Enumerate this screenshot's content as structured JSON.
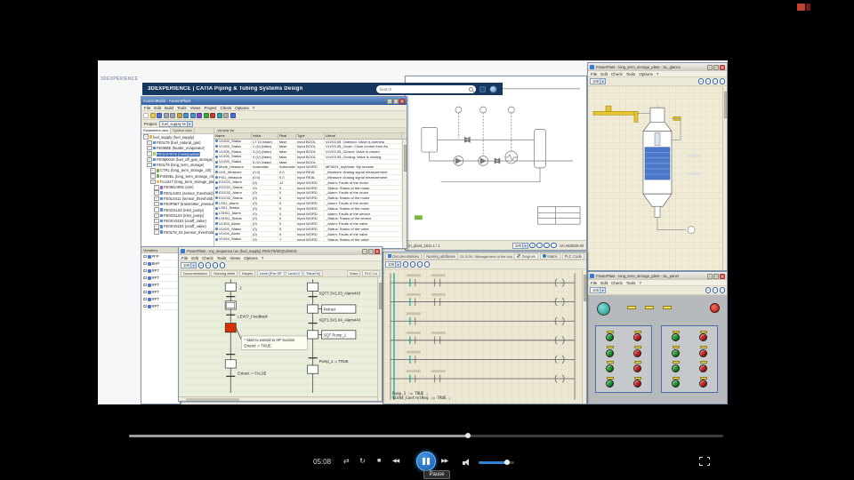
{
  "chrome": {
    "minimize": "–",
    "maximize": "□",
    "close": "×",
    "dropdown": "▾"
  },
  "player_icons": {
    "shuffle": "⇄",
    "repeat": "↻",
    "stop": "■",
    "rewind": "◀◀",
    "forward": "▶▶"
  },
  "desktop": {
    "logo": "3DEXPERIENCE",
    "top_bar": {
      "title": "3DEXPERIENCE | CATIA Piping & Tubing Systems Design",
      "search_placeholder": "Search"
    }
  },
  "controlbuild": {
    "title": "ControlBuild - AssemPlant",
    "menus": [
      "File",
      "Edit",
      "Build",
      "Tools",
      "Views",
      "Project",
      "Check",
      "Options",
      "?"
    ],
    "toolbar_icons": [
      {
        "name": "new-icon",
        "color": "#f8f8f8"
      },
      {
        "name": "open-icon",
        "color": "#e8c84a"
      },
      {
        "name": "save-icon",
        "color": "#4a6fd0"
      },
      {
        "name": "cut-icon",
        "color": "#9aa4b8"
      },
      {
        "name": "copy-icon",
        "color": "#9aa4b8"
      },
      {
        "name": "paste-icon",
        "color": "#c8a24a"
      },
      {
        "name": "undo-icon",
        "color": "#4a8fd0"
      },
      {
        "name": "redo-icon",
        "color": "#4a8fd0"
      },
      {
        "name": "compile-icon",
        "color": "#7a4ad0"
      },
      {
        "name": "run-icon",
        "color": "#3aa83a"
      },
      {
        "name": "stop-icon",
        "color": "#c83a3a"
      },
      {
        "name": "debug-icon",
        "color": "#3a9aa8"
      },
      {
        "name": "grid-icon",
        "color": "#b0b0b0"
      },
      {
        "name": "help-icon",
        "color": "#4a6fd0"
      }
    ],
    "project_label": "Project",
    "project_value": "fuel_supply M",
    "tree_tabs": [
      "Parameters view",
      "System view"
    ],
    "tree": [
      {
        "label": "fuel_supply (fuel_supply)",
        "depth": 0,
        "icon": "#e8b64c"
      },
      {
        "label": "FE0LT9 (fuel_natural_gas)",
        "depth": 1,
        "icon": "#5b8dd9"
      },
      {
        "label": "FE09ME (heater_evaporator)",
        "depth": 1,
        "icon": "#5b8dd9"
      },
      {
        "label": "FE0U3-RC9 (messpunkte)",
        "depth": 1,
        "icon": "#9ad94c",
        "cls": "selected"
      },
      {
        "label": "FE0M0010 (fuel_off_gas_storage)",
        "depth": 1,
        "icon": "#5b8dd9"
      },
      {
        "label": "FE0LT9 (long_term_storage)",
        "depth": 1,
        "icon": "#5b8dd9"
      },
      {
        "label": "CTRL (long_term_storage_ctrl)",
        "depth": 2,
        "icon": "#7aa84c"
      },
      {
        "label": "FI049EL (long_term_storage_ctrl)",
        "depth": 2,
        "icon": "#7aa84c"
      },
      {
        "label": "FLU417 (long_term_storage_plant)",
        "depth": 2,
        "icon": "#e8b64c"
      },
      {
        "label": "FE09GA891 (sim)",
        "depth": 3,
        "icon": "#b05bd9"
      },
      {
        "label": "FE0LS401 (sensor_threshold)",
        "depth": 3,
        "icon": "#5b8dd9"
      },
      {
        "label": "FE0LS411 (sensor_threshold)",
        "depth": 3,
        "icon": "#5b8dd9"
      },
      {
        "label": "FE0P987 (transmitter_pressure)",
        "depth": 3,
        "icon": "#5b8dd9"
      },
      {
        "label": "FE0GSL02 (inlet_pump)",
        "depth": 3,
        "icon": "#5b8dd9"
      },
      {
        "label": "FE0GSL03 (inlet_pump)",
        "depth": 3,
        "icon": "#5b8dd9"
      },
      {
        "label": "FE0SV5103 (onoff_valve)",
        "depth": 3,
        "icon": "#5b8dd9"
      },
      {
        "label": "FE0SV5104 (onoff_valve)",
        "depth": 3,
        "icon": "#5b8dd9"
      },
      {
        "label": "FE0LT9_04 (sensor_threshold)",
        "depth": 3,
        "icon": "#5b8dd9"
      }
    ],
    "table_tab": "Variable list",
    "table": {
      "headers": [
        "Name",
        "Initial",
        "Real",
        "Type",
        "Literal"
      ],
      "rows": [
        [
          "VLV05_Status",
          "LT 10 (false)",
          "false",
          "Input BOOL",
          "VLV03.05_Opening: Valve is opening"
        ],
        [
          "VLV05_Status",
          "2 (U) (false)",
          "false",
          "Input BOOL",
          "VLV03.05_Close: Close control from Au"
        ],
        [
          "VLV05_Status",
          "3 (U) (false)",
          "false",
          "Input BOOL",
          "VLV03.05_Closed: Valve is closed"
        ],
        [
          "VLV05_Status",
          "4 (U) (false)",
          "false",
          "Input BOOL",
          "VLV03.05_Closing: Valve is closing"
        ],
        [
          "VLV05_Status",
          "5 (U) (false)",
          "false",
          "Input BOOL",
          ""
        ],
        [
          "Mode_Measure",
          "Automatic",
          "Automatic",
          "Input WORD",
          "MF5001_myMode: My module"
        ],
        [
          "LI01_Measure",
          "(0.0)",
          "0.0",
          "Input REAL",
          "_Measure: Analog signal measurement"
        ],
        [
          "PI01_Measure",
          "(0.0)",
          "0.0",
          "Input REAL",
          "_Measure: Analog signal measurement"
        ],
        [
          "EGC01_Alarm",
          "(0)",
          "12",
          "Input WORD",
          "_Alarm: Faults of the motor"
        ],
        [
          "EGC01_Status",
          "(0)",
          "3",
          "Input WORD",
          "_Status: Status of the motor"
        ],
        [
          "EGC02_Alarm",
          "(0)",
          "0",
          "Input WORD",
          "_Alarm: Faults of the motor"
        ],
        [
          "EGC02_Status",
          "(0)",
          "5",
          "Input WORD",
          "_Status: Status of the motor"
        ],
        [
          "LS01_Alarm",
          "(0)",
          "0",
          "Input WORD",
          "_Alarm: Faults of the motor"
        ],
        [
          "LS01_Status",
          "(0)",
          "0",
          "Input WORD",
          "_Status: Status of the motor"
        ],
        [
          "LSH01_Alarm",
          "(0)",
          "0",
          "Input WORD",
          "_Alarm: Faults of the sensor"
        ],
        [
          "LSH01_Status",
          "(0)",
          "0",
          "Input WORD",
          "_Status: Status of the sensor"
        ],
        [
          "VLV03_Alarm",
          "(0)",
          "0",
          "Input WORD",
          "_Alarm: Faults of the valve"
        ],
        [
          "VLV03_Status",
          "(0)",
          "5",
          "Input WORD",
          "_Status: Status of the valve"
        ],
        [
          "VLV04_Alarm",
          "(0)",
          "0",
          "Input WORD",
          "_Alarm: Faults of the valve"
        ],
        [
          "VLV04_Status",
          "(0)",
          "7",
          "Input WORD",
          "_Status: Status of the valve"
        ]
      ]
    }
  },
  "pid_window": {
    "status": "rn_plant_1811.1 / 1",
    "sheet": "cm A82030-40",
    "zoom": "100"
  },
  "reactor_window": {
    "title": "PowerPlant - long_term_storage_plant - SL_glance",
    "menus": [
      "File",
      "Edit",
      "Check",
      "Tools",
      "Options",
      "?"
    ],
    "zoom": "100"
  },
  "panel_window": {
    "title": "PowerPlant - long_term_storage_plant - SL_panel",
    "menus": [
      "File",
      "Edit",
      "Check",
      "Tools",
      "?"
    ],
    "zoom": "100",
    "buttons_left": [
      {
        "name": "start-button",
        "color": "#1f9d2f"
      },
      {
        "name": "stop-button",
        "color": "#cc2020"
      },
      {
        "name": "start-button",
        "color": "#1f9d2f"
      },
      {
        "name": "stop-button",
        "color": "#cc2020"
      },
      {
        "name": "start-button",
        "color": "#1f9d2f"
      },
      {
        "name": "stop-button",
        "color": "#cc2020"
      },
      {
        "name": "start-button",
        "color": "#1f9d2f"
      },
      {
        "name": "stop-button",
        "color": "#cc2020"
      }
    ],
    "buttons_right": [
      {
        "name": "start-button",
        "color": "#1f9d2f"
      },
      {
        "name": "stop-button",
        "color": "#cc2020"
      },
      {
        "name": "start-button",
        "color": "#1f9d2f"
      },
      {
        "name": "stop-button",
        "color": "#cc2020"
      },
      {
        "name": "start-button",
        "color": "#1f9d2f"
      },
      {
        "name": "stop-button",
        "color": "#cc2020"
      },
      {
        "name": "start-button",
        "color": "#1f9d2f"
      },
      {
        "name": "stop-button",
        "color": "#cc2020"
      }
    ]
  },
  "ladder_window": {
    "tabs": [
      "Documentations",
      "Naming attributes"
    ],
    "doc_title": "SL 5.05 : Management of the long_term_storage",
    "view_tabs": [
      "Diagram",
      "Matrix",
      "PLC Code"
    ],
    "zoom": "100",
    "code_line1": "Pump_1 := TRUE ;",
    "code_line2": "VLV04_ControlReq := TRUE ;"
  },
  "sfc_window": {
    "title": "PowerPlant - my_sequence.run (fuel_supply) FE0LT9/SEQUENCE",
    "menus": [
      "File",
      "Edit",
      "Check",
      "Tools",
      "Views",
      "Options",
      "?"
    ],
    "zoom": "100",
    "doc_tabs": [
      "Documentation",
      "Naming attrib",
      "Haupts"
    ],
    "level_tabs": [
      "Level (Pre SP",
      "Level 2",
      "Panel S("
    ],
    "right_tabs": [
      "Mard",
      "PLC Co"
    ],
    "chart": {
      "step_number": "2",
      "t1_label": "LEV07_Feedback",
      "note_line1": "* Start to extend to HP Suction",
      "note_line2": "Extend := TRUE",
      "left_bottom": "Extract := FALSE",
      "r_t1_label": "SQT7.SV1.03_Alarm443",
      "r_action1": "Retract",
      "r_t2_label": "SQT1.SV1.04_Alarm443",
      "r_action2": "SQT Pump_1",
      "r_bottom": "Pump_1 := TRUE"
    }
  },
  "variables_panel": {
    "tab": "Variables",
    "items": [
      {
        "label": "PFP"
      },
      {
        "label": "BHP"
      },
      {
        "label": "RPT"
      },
      {
        "label": "RPT"
      },
      {
        "label": "RPT"
      },
      {
        "label": "RPT"
      },
      {
        "label": "RPT"
      },
      {
        "label": "RPT"
      }
    ]
  },
  "player": {
    "time": "05:08",
    "tooltip": "Pause",
    "progress_percent": 57,
    "volume_percent": 80
  }
}
